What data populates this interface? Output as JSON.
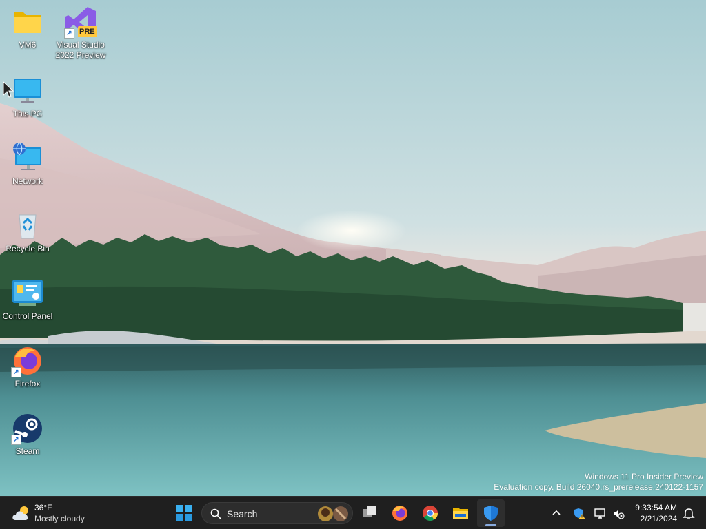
{
  "desktop": {
    "icons": [
      {
        "label": "VM6",
        "icon": "folder-icon"
      },
      {
        "label": "Visual Studio\n2022 Preview",
        "icon": "visual-studio-icon",
        "badge": "PRE"
      },
      {
        "label": "This PC",
        "icon": "this-pc-icon"
      },
      {
        "label": "Network",
        "icon": "network-icon"
      },
      {
        "label": "Recycle Bin",
        "icon": "recycle-bin-icon"
      },
      {
        "label": "Control Panel",
        "icon": "control-panel-icon"
      },
      {
        "label": "Firefox",
        "icon": "firefox-icon"
      },
      {
        "label": "Steam",
        "icon": "steam-icon"
      }
    ],
    "watermark": {
      "line1": "Windows 11 Pro Insider Preview",
      "line2": "Evaluation copy. Build 26040.rs_prerelease.240122-1157"
    }
  },
  "taskbar": {
    "weather": {
      "temp": "36°F",
      "condition": "Mostly cloudy",
      "icon": "cloud-icon"
    },
    "search_label": "Search",
    "pinned": [
      "start-icon",
      "search-icon",
      "task-view-icon",
      "firefox-icon",
      "chrome-icon",
      "file-explorer-icon",
      "windows-security-icon"
    ],
    "tray": [
      "chevron-up-icon",
      "defender-warning-icon",
      "network-off-icon",
      "volume-mute-icon"
    ],
    "clock": {
      "time": "9:33:54 AM",
      "date": "2/21/2024"
    },
    "notifications_icon": "bell-icon"
  },
  "colors": {
    "taskbar_bg": "#1f1f1f",
    "accent": "#0067c0"
  }
}
